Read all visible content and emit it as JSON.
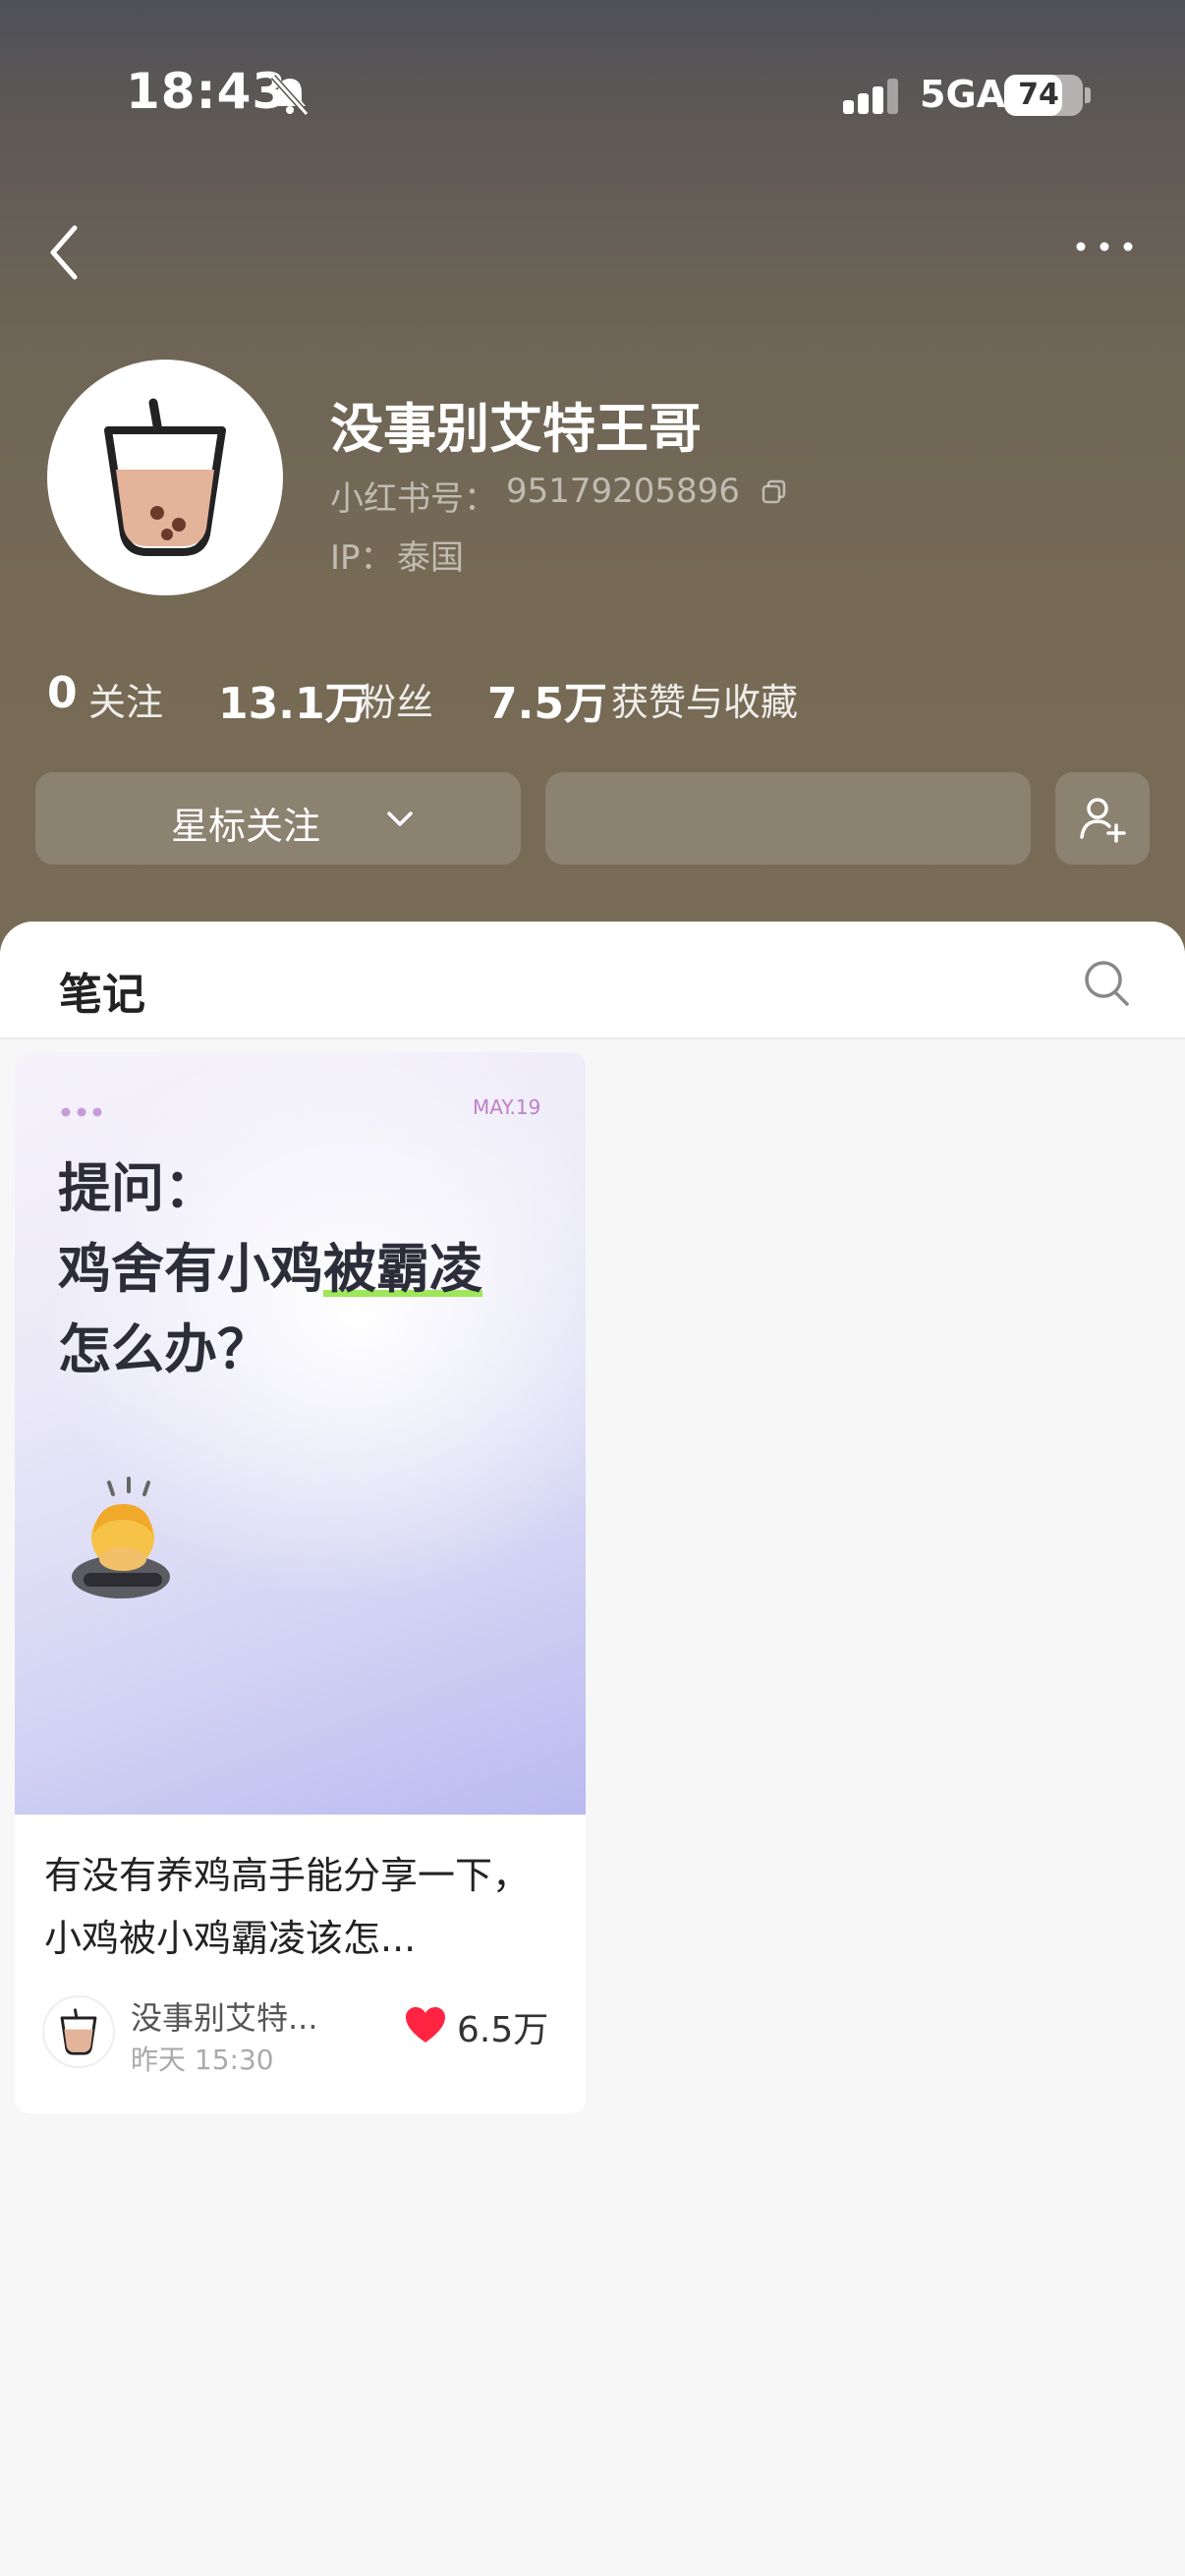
{
  "status_bar": {
    "time": "18:43",
    "network": "5GA",
    "battery": "74",
    "battery_level": 0.74,
    "icons": [
      "bell-muted-icon",
      "signal-icon",
      "battery-icon"
    ]
  },
  "nav": {
    "icons": [
      "back-icon",
      "more-icon"
    ]
  },
  "profile": {
    "nickname": "没事别艾特王哥",
    "id_label": "小红书号：",
    "id_value": "95179205896",
    "ip_label": "IP：",
    "ip_value": "泰国",
    "avatar_icon": "bubble-tea-icon"
  },
  "stats": {
    "following_count": "0",
    "following_label": "关注",
    "followers_count": "13.1万",
    "followers_label": "粉丝",
    "likes_count": "7.5万",
    "likes_label": "获赞与收藏"
  },
  "actions": {
    "star_follow_label": "星标关注",
    "icons": [
      "chevron-down-icon",
      "add-friend-icon"
    ]
  },
  "tabs": {
    "notes_label": "笔记",
    "icons": [
      "search-icon"
    ]
  },
  "note": {
    "cover_date": "MAY.19",
    "cover_line1": "提问：",
    "cover_line2a": "鸡舍有小鸡",
    "cover_line2b": "被霸凌",
    "cover_line3": "怎么办？",
    "title": "有没有养鸡高手能分享一下，小鸡被小鸡霸凌该怎...",
    "author": "没事别艾特...",
    "time": "昨天 15:30",
    "likes": "6.5万",
    "icons": [
      "bowing-person-icon",
      "heart-icon"
    ]
  },
  "colors": {
    "header_top": "#4f5058",
    "header_bottom": "#786c56",
    "cover_purple": "#b9baf0",
    "highlight_green": "#9ee65a",
    "heart_red": "#ff2442"
  }
}
